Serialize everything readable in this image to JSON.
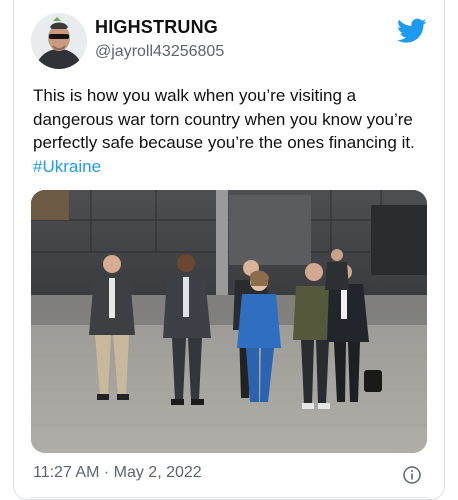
{
  "tweet": {
    "display_name": "HIGHSTRUNG",
    "handle": "@jayroll43256805",
    "text_main": "This is how you walk when you’re visiting a dangerous war torn country when you know you’re perfectly safe because you’re the ones financing it. ",
    "hashtag": "#Ukraine",
    "timestamp": "11:27 AM · May 2, 2022",
    "brand_color": "#1d9bf0"
  },
  "icons": {
    "logo": "twitter-bird-icon",
    "info": "info-icon"
  }
}
